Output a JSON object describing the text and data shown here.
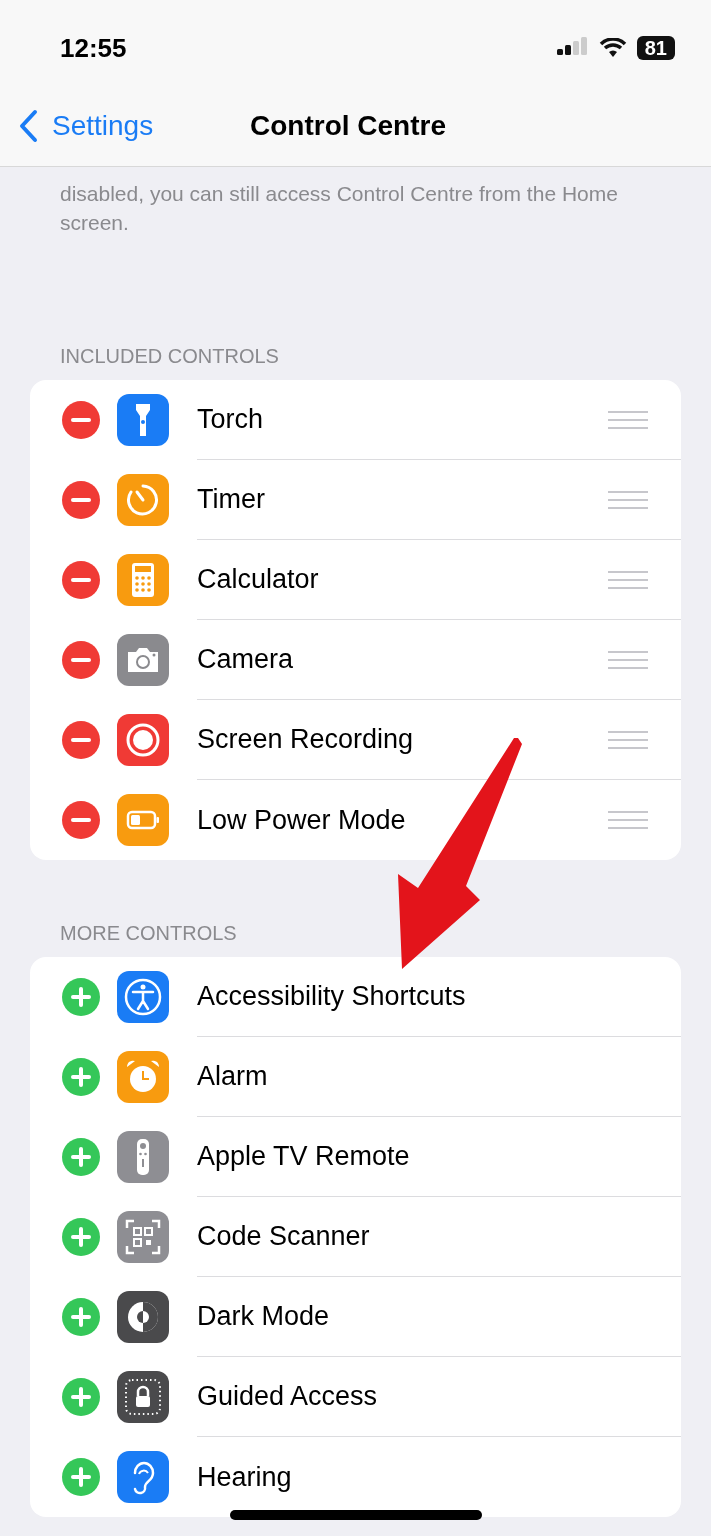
{
  "status_bar": {
    "time": "12:55",
    "battery": "81"
  },
  "nav": {
    "back": "Settings",
    "title": "Control Centre"
  },
  "description": "disabled, you can still access Control Centre from the Home screen.",
  "sections": [
    {
      "header": "INCLUDED CONTROLS",
      "kind": "included",
      "items": [
        {
          "label": "Torch",
          "color": "#1a7cf5"
        },
        {
          "label": "Timer",
          "color": "#f89b0f"
        },
        {
          "label": "Calculator",
          "color": "#f89b0f"
        },
        {
          "label": "Camera",
          "color": "#8a8a8e"
        },
        {
          "label": "Screen Recording",
          "color": "#f03a35"
        },
        {
          "label": "Low Power Mode",
          "color": "#f89b0f"
        }
      ]
    },
    {
      "header": "MORE CONTROLS",
      "kind": "more",
      "items": [
        {
          "label": "Accessibility Shortcuts",
          "color": "#1a7cf5"
        },
        {
          "label": "Alarm",
          "color": "#f89b0f"
        },
        {
          "label": "Apple TV Remote",
          "color": "#8e8e93"
        },
        {
          "label": "Code Scanner",
          "color": "#8e8e93"
        },
        {
          "label": "Dark Mode",
          "color": "#4a4a4c"
        },
        {
          "label": "Guided Access",
          "color": "#4a4a4c"
        },
        {
          "label": "Hearing",
          "color": "#1a7cf5"
        }
      ]
    }
  ]
}
